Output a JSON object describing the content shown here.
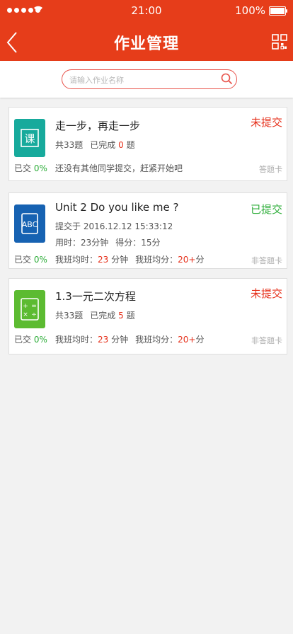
{
  "status_bar": {
    "time": "21:00",
    "battery": "100%"
  },
  "nav": {
    "title": "作业管理",
    "back_icon": "chevron-left-icon",
    "grid_icon": "grid-icon"
  },
  "search": {
    "placeholder": "请输入作业名称",
    "value": ""
  },
  "colors": {
    "header": "#e63d1a",
    "unsubmitted": "#e6311c",
    "submitted": "#2fae3b",
    "icon_teal": "#17aa9c",
    "icon_blue": "#1662b2",
    "icon_green": "#5cbb31"
  },
  "cards": [
    {
      "title": "走一步，再走一步",
      "status": "未提交",
      "icon": "chinese-icon",
      "total": "共33题",
      "done_prefix": "已完成",
      "done_count": "0",
      "done_suffix": "题",
      "submitted_label": "已交",
      "submitted_pct": "0%",
      "footer_text": "还没有其他同学提交，赶紧开始吧",
      "card_type": "答题卡"
    },
    {
      "title": "Unit 2  Do you like me ?",
      "status": "已提交",
      "icon": "abc-icon",
      "submit_time": "提交于 2016.12.12 15:33:12",
      "time_used": "用时：23分钟",
      "score": "得分：15分",
      "submitted_label": "已交",
      "submitted_pct": "0%",
      "avg_time_label": "我班均时：",
      "avg_time_value": "23",
      "avg_time_unit": "分钟",
      "avg_score_label": "我班均分：",
      "avg_score_value": "20+",
      "avg_score_unit": "分",
      "card_type": "非答题卡"
    },
    {
      "title": "1.3一元二次方程",
      "status": "未提交",
      "icon": "math-icon",
      "total": "共33题",
      "done_prefix": "已完成",
      "done_count": "5",
      "done_suffix": "题",
      "submitted_label": "已交",
      "submitted_pct": "0%",
      "avg_time_label": "我班均时：",
      "avg_time_value": "23",
      "avg_time_unit": "分钟",
      "avg_score_label": "我班均分：",
      "avg_score_value": "20+",
      "avg_score_unit": "分",
      "card_type": "非答题卡"
    }
  ]
}
